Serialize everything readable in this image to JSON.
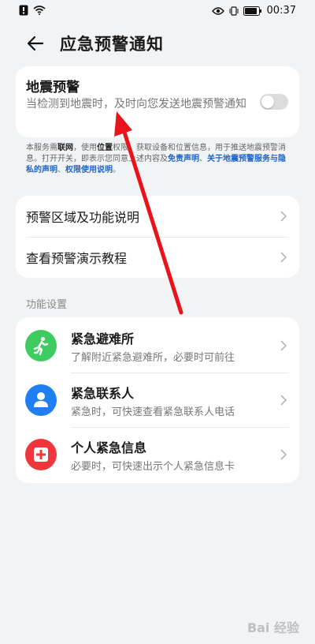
{
  "status": {
    "time": "00:37"
  },
  "header": {
    "title": "应急预警通知"
  },
  "earthquake": {
    "title": "地震预警",
    "subtitle": "当检测到地震时，及时向您发送地震预警通知",
    "enabled": false
  },
  "notice": {
    "part1": "本服务需",
    "network": "联网",
    "part2": "，使用",
    "location": "位置",
    "part3": "权限，获取设备和位置信息，用于推送地震预警消息。打开开关，即表示您同意上述内容及",
    "link1": "免责声明",
    "sep1": "、",
    "link2": "关于地震预警服务与隐私的声明",
    "sep2": "、",
    "link3": "权限使用说明",
    "end": "。"
  },
  "info_rows": [
    {
      "label": "预警区域及功能说明"
    },
    {
      "label": "查看预警演示教程"
    }
  ],
  "section_title": "功能设置",
  "features": [
    {
      "title": "紧急避难所",
      "subtitle": "了解附近紧急避难所，必要时可前往",
      "icon": "running-person-icon",
      "color": "#3ecb5f"
    },
    {
      "title": "紧急联系人",
      "subtitle": "紧急时，可快速查看紧急联系人电话",
      "icon": "contact-person-icon",
      "color": "#1f7ef2"
    },
    {
      "title": "个人紧急信息",
      "subtitle": "必要时，可快速出示个人紧急信息卡",
      "icon": "medical-cross-icon",
      "color": "#f0353d"
    }
  ],
  "watermark": "Bai 经验"
}
